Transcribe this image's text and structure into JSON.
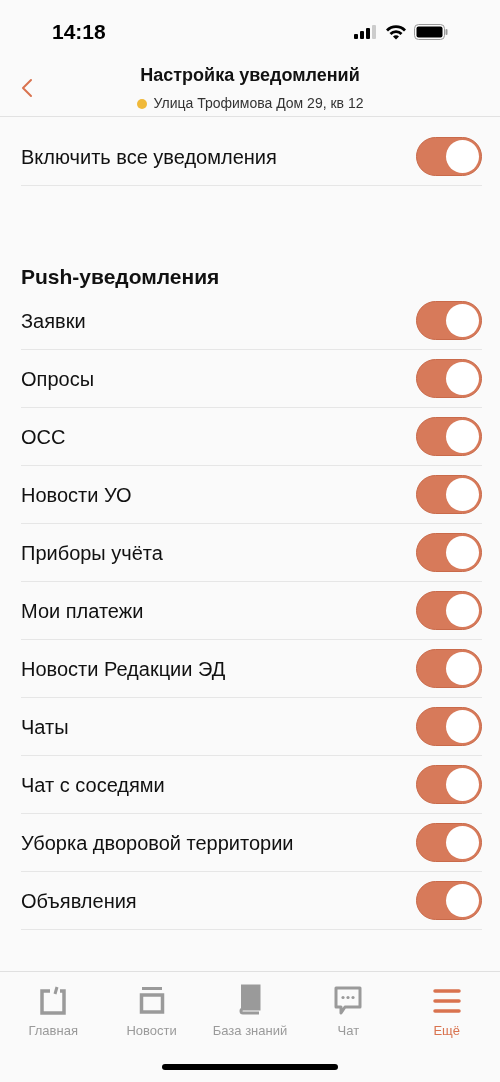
{
  "status_bar": {
    "time": "14:18"
  },
  "header": {
    "title": "Настройка уведомлений",
    "address": "Улица Трофимова Дом 29, кв 12"
  },
  "master": {
    "label": "Включить все уведомления",
    "on": true
  },
  "section": {
    "title": "Push-уведомления",
    "items": [
      {
        "label": "Заявки",
        "on": true
      },
      {
        "label": "Опросы",
        "on": true
      },
      {
        "label": "ОСС",
        "on": true
      },
      {
        "label": "Новости УО",
        "on": true
      },
      {
        "label": "Приборы учёта",
        "on": true
      },
      {
        "label": "Мои платежи",
        "on": true
      },
      {
        "label": "Новости Редакции ЭД",
        "on": true
      },
      {
        "label": "Чаты",
        "on": true
      },
      {
        "label": "Чат с соседями",
        "on": true
      },
      {
        "label": "Уборка дворовой территории",
        "on": true
      },
      {
        "label": "Объявления",
        "on": true
      }
    ]
  },
  "tab_bar": [
    {
      "kind": "home",
      "label": "Главная",
      "selected": false
    },
    {
      "kind": "news",
      "label": "Новости",
      "selected": false
    },
    {
      "kind": "book",
      "label": "База знаний",
      "selected": false
    },
    {
      "kind": "chat",
      "label": "Чат",
      "selected": false
    },
    {
      "kind": "menu",
      "label": "Ещё",
      "selected": true
    }
  ]
}
